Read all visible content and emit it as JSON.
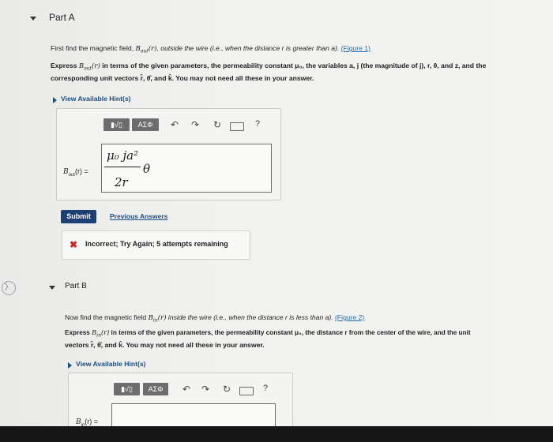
{
  "partA": {
    "title": "Part A",
    "line1_prefix": "First find the magnetic field, ",
    "line1_sym": "B",
    "line1_sub": "out",
    "line1_arg": "(r)",
    "line1_suffix": ", outside the wire (i.e., when the distance r is greater than a). ",
    "line1_link": "(Figure 1)",
    "line2_prefix": "Express ",
    "line2_sym": "B",
    "line2_sub": "out",
    "line2_arg": "(r)",
    "line2_suffix": " in terms of the given parameters, the permeability constant μ₀, the variables a, j (the magnitude of j), r, θ, and z, and the",
    "line3": "corresponding unit vectors r̂, θ̂, and k̂. You may not need all these in your answer.",
    "hint": "View Available Hint(s)",
    "toolbar": {
      "templates": "▮√▯",
      "greek": "ΑΣΦ",
      "help": "?"
    },
    "answer_label_sym": "B",
    "answer_label_sub": "out",
    "answer_label_arg": "(r) =",
    "answer": {
      "numerator": "μ₀ ja²",
      "denominator": "2r",
      "variable": "θ"
    },
    "submit": "Submit",
    "previous": "Previous Answers",
    "feedback": "Incorrect; Try Again; 5 attempts remaining"
  },
  "partB": {
    "title": "Part B",
    "line1_prefix": "Now find the magnetic field ",
    "line1_sym": "B",
    "line1_sub": "in",
    "line1_arg": "(r)",
    "line1_suffix": " inside the wire (i.e., when the distance r is less than a). ",
    "line1_link": "(Figure 2)",
    "line2_prefix": "Express ",
    "line2_sym": "B",
    "line2_sub": "in",
    "line2_arg": "(r)",
    "line2_suffix": " in terms of the given parameters, the permeability constant μ₀, the distance r from the center of the wire, and the unit",
    "line3": "vectors r̂, θ̂, and k̂. You may not need all these in your answer.",
    "hint": "View Available Hint(s)",
    "toolbar": {
      "templates": "▮√▯",
      "greek": "ΑΣΦ",
      "help": "?"
    },
    "answer_label_sym": "B",
    "answer_label_sub": "in",
    "answer_label_arg": "(r) ="
  },
  "side_nav": {
    "symbol": "〉"
  }
}
